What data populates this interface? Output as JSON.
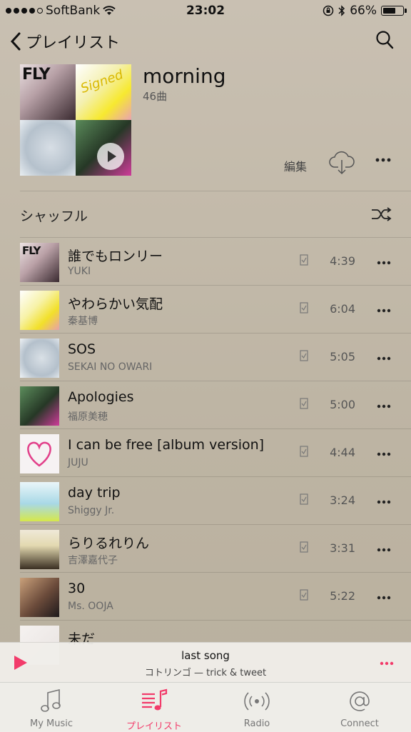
{
  "status": {
    "carrier": "SoftBank",
    "time": "23:02",
    "battery": "66%",
    "battery_level": 0.66
  },
  "nav": {
    "back_label": "プレイリスト"
  },
  "playlist": {
    "title": "morning",
    "count": "46曲",
    "edit_label": "編集"
  },
  "shuffle": {
    "label": "シャッフル"
  },
  "tracks": [
    {
      "title": "誰でもロンリー",
      "artist": "YUKI",
      "duration": "4:39"
    },
    {
      "title": "やわらかい気配",
      "artist": "秦基博",
      "duration": "6:04"
    },
    {
      "title": "SOS",
      "artist": "SEKAI NO OWARI",
      "duration": "5:05"
    },
    {
      "title": "Apologies",
      "artist": "福原美穂",
      "duration": "5:00"
    },
    {
      "title": "I can be free [album version]",
      "artist": "JUJU",
      "duration": "4:44"
    },
    {
      "title": "day trip",
      "artist": "Shiggy Jr.",
      "duration": "3:24"
    },
    {
      "title": "らりるれりん",
      "artist": "吉澤嘉代子",
      "duration": "3:31"
    },
    {
      "title": "30",
      "artist": "Ms. OOJA",
      "duration": "5:22"
    },
    {
      "title": "未だ",
      "artist": "",
      "duration": ""
    }
  ],
  "mini_player": {
    "title": "last song",
    "subtitle": "コトリンゴ — trick & tweet"
  },
  "tabs": [
    {
      "label": "My Music",
      "icon": "music-note-icon"
    },
    {
      "label": "プレイリスト",
      "icon": "playlist-icon",
      "active": true
    },
    {
      "label": "Radio",
      "icon": "radio-icon"
    },
    {
      "label": "Connect",
      "icon": "at-sign-icon"
    }
  ],
  "colors": {
    "accent": "#f23b6a"
  }
}
